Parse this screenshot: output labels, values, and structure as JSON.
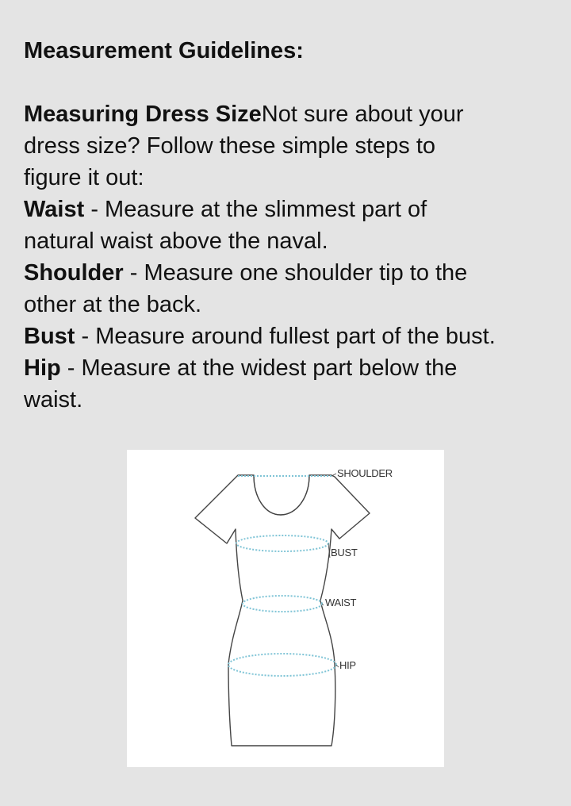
{
  "guidelines": {
    "title": "Measurement Guidelines:",
    "intro": {
      "term": "Measuring Dress Size",
      "text_line1": "Not sure about your",
      "text_line2": "dress size? Follow these simple steps to",
      "text_line3": "figure it out:"
    },
    "items": [
      {
        "term": "Waist",
        "line1": " - Measure at the slimmest part of",
        "line2": "natural waist above the naval."
      },
      {
        "term": "Shoulder",
        "line1": " - Measure one shoulder tip to the",
        "line2": "other at the back."
      },
      {
        "term": "Bust",
        "line1": " - Measure around fullest part of the bust.",
        "line2": ""
      },
      {
        "term": "Hip",
        "line1": " - Measure at the widest part below the",
        "line2": "waist."
      }
    ]
  },
  "diagram": {
    "labels": {
      "shoulder": "SHOULDER",
      "bust": "BUST",
      "waist": "WAIST",
      "hip": "HIP"
    },
    "colors": {
      "outline": "#444444",
      "measure_line": "#7fc4d6"
    }
  }
}
